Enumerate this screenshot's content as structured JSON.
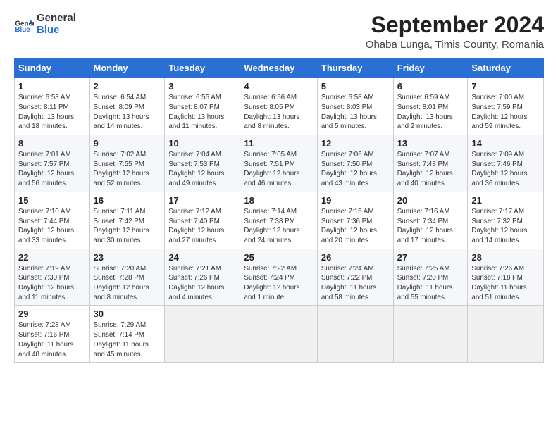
{
  "header": {
    "logo_general": "General",
    "logo_blue": "Blue",
    "month_title": "September 2024",
    "location": "Ohaba Lunga, Timis County, Romania"
  },
  "calendar": {
    "columns": [
      "Sunday",
      "Monday",
      "Tuesday",
      "Wednesday",
      "Thursday",
      "Friday",
      "Saturday"
    ],
    "rows": [
      [
        {
          "day": "1",
          "info": "Sunrise: 6:53 AM\nSunset: 8:11 PM\nDaylight: 13 hours\nand 18 minutes."
        },
        {
          "day": "2",
          "info": "Sunrise: 6:54 AM\nSunset: 8:09 PM\nDaylight: 13 hours\nand 14 minutes."
        },
        {
          "day": "3",
          "info": "Sunrise: 6:55 AM\nSunset: 8:07 PM\nDaylight: 13 hours\nand 11 minutes."
        },
        {
          "day": "4",
          "info": "Sunrise: 6:56 AM\nSunset: 8:05 PM\nDaylight: 13 hours\nand 8 minutes."
        },
        {
          "day": "5",
          "info": "Sunrise: 6:58 AM\nSunset: 8:03 PM\nDaylight: 13 hours\nand 5 minutes."
        },
        {
          "day": "6",
          "info": "Sunrise: 6:59 AM\nSunset: 8:01 PM\nDaylight: 13 hours\nand 2 minutes."
        },
        {
          "day": "7",
          "info": "Sunrise: 7:00 AM\nSunset: 7:59 PM\nDaylight: 12 hours\nand 59 minutes."
        }
      ],
      [
        {
          "day": "8",
          "info": "Sunrise: 7:01 AM\nSunset: 7:57 PM\nDaylight: 12 hours\nand 56 minutes."
        },
        {
          "day": "9",
          "info": "Sunrise: 7:02 AM\nSunset: 7:55 PM\nDaylight: 12 hours\nand 52 minutes."
        },
        {
          "day": "10",
          "info": "Sunrise: 7:04 AM\nSunset: 7:53 PM\nDaylight: 12 hours\nand 49 minutes."
        },
        {
          "day": "11",
          "info": "Sunrise: 7:05 AM\nSunset: 7:51 PM\nDaylight: 12 hours\nand 46 minutes."
        },
        {
          "day": "12",
          "info": "Sunrise: 7:06 AM\nSunset: 7:50 PM\nDaylight: 12 hours\nand 43 minutes."
        },
        {
          "day": "13",
          "info": "Sunrise: 7:07 AM\nSunset: 7:48 PM\nDaylight: 12 hours\nand 40 minutes."
        },
        {
          "day": "14",
          "info": "Sunrise: 7:09 AM\nSunset: 7:46 PM\nDaylight: 12 hours\nand 36 minutes."
        }
      ],
      [
        {
          "day": "15",
          "info": "Sunrise: 7:10 AM\nSunset: 7:44 PM\nDaylight: 12 hours\nand 33 minutes."
        },
        {
          "day": "16",
          "info": "Sunrise: 7:11 AM\nSunset: 7:42 PM\nDaylight: 12 hours\nand 30 minutes."
        },
        {
          "day": "17",
          "info": "Sunrise: 7:12 AM\nSunset: 7:40 PM\nDaylight: 12 hours\nand 27 minutes."
        },
        {
          "day": "18",
          "info": "Sunrise: 7:14 AM\nSunset: 7:38 PM\nDaylight: 12 hours\nand 24 minutes."
        },
        {
          "day": "19",
          "info": "Sunrise: 7:15 AM\nSunset: 7:36 PM\nDaylight: 12 hours\nand 20 minutes."
        },
        {
          "day": "20",
          "info": "Sunrise: 7:16 AM\nSunset: 7:34 PM\nDaylight: 12 hours\nand 17 minutes."
        },
        {
          "day": "21",
          "info": "Sunrise: 7:17 AM\nSunset: 7:32 PM\nDaylight: 12 hours\nand 14 minutes."
        }
      ],
      [
        {
          "day": "22",
          "info": "Sunrise: 7:19 AM\nSunset: 7:30 PM\nDaylight: 12 hours\nand 11 minutes."
        },
        {
          "day": "23",
          "info": "Sunrise: 7:20 AM\nSunset: 7:28 PM\nDaylight: 12 hours\nand 8 minutes."
        },
        {
          "day": "24",
          "info": "Sunrise: 7:21 AM\nSunset: 7:26 PM\nDaylight: 12 hours\nand 4 minutes."
        },
        {
          "day": "25",
          "info": "Sunrise: 7:22 AM\nSunset: 7:24 PM\nDaylight: 12 hours\nand 1 minute."
        },
        {
          "day": "26",
          "info": "Sunrise: 7:24 AM\nSunset: 7:22 PM\nDaylight: 11 hours\nand 58 minutes."
        },
        {
          "day": "27",
          "info": "Sunrise: 7:25 AM\nSunset: 7:20 PM\nDaylight: 11 hours\nand 55 minutes."
        },
        {
          "day": "28",
          "info": "Sunrise: 7:26 AM\nSunset: 7:18 PM\nDaylight: 11 hours\nand 51 minutes."
        }
      ],
      [
        {
          "day": "29",
          "info": "Sunrise: 7:28 AM\nSunset: 7:16 PM\nDaylight: 11 hours\nand 48 minutes."
        },
        {
          "day": "30",
          "info": "Sunrise: 7:29 AM\nSunset: 7:14 PM\nDaylight: 11 hours\nand 45 minutes."
        },
        {
          "day": "",
          "info": ""
        },
        {
          "day": "",
          "info": ""
        },
        {
          "day": "",
          "info": ""
        },
        {
          "day": "",
          "info": ""
        },
        {
          "day": "",
          "info": ""
        }
      ]
    ]
  }
}
